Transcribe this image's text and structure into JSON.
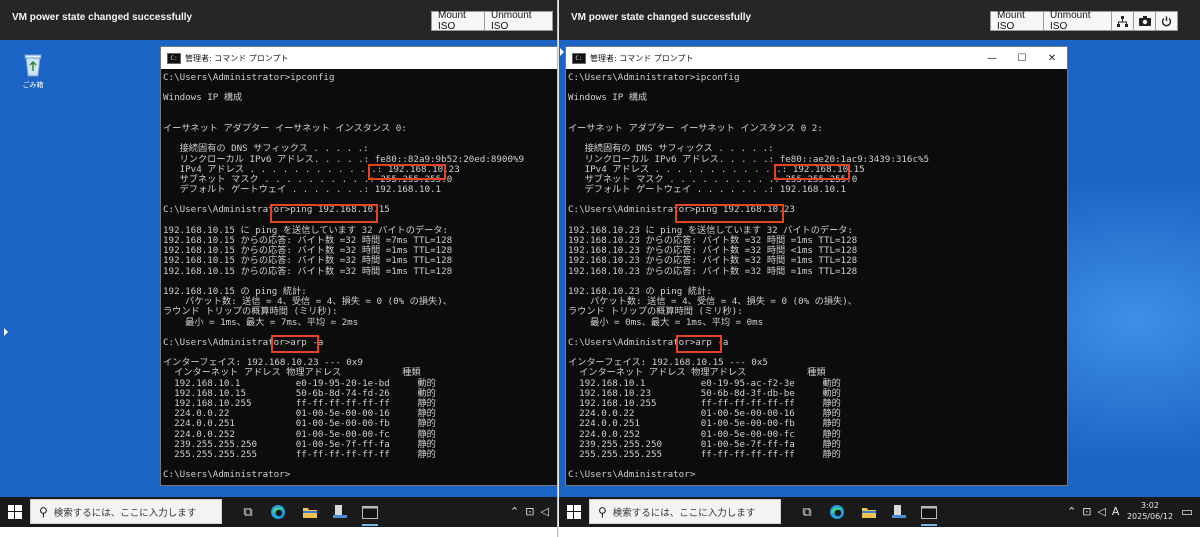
{
  "vm_status": "VM power state changed successfully",
  "buttons": {
    "mount_iso": "Mount ISO",
    "unmount_iso": "Unmount ISO"
  },
  "desktop": {
    "recycle_bin_label": "ごみ箱"
  },
  "cmd_title": "管理者: コマンド プロンプト",
  "taskbar": {
    "search_placeholder": "検索するには、ここに入力します",
    "ime": "A",
    "time": "3:02",
    "date": "2025/06/12"
  },
  "window_controls": {
    "minimize": "—",
    "maximize": "☐",
    "close": "✕"
  },
  "left_console": [
    "C:\\Users\\Administrator>ipconfig",
    "",
    "Windows IP 構成",
    "",
    "",
    "イーサネット アダプター イーサネット インスタンス 0:",
    "",
    "   接続固有の DNS サフィックス . . . . .:",
    "   リンクローカル IPv6 アドレス. . . . .: fe80::82a9:9b52:20ed:8900%9",
    "   IPv4 アドレス . . . . . . . . . . . .: 192.168.10.23",
    "   サブネット マスク . . . . . . . . . .: 255.255.255.0",
    "   デフォルト ゲートウェイ . . . . . . .: 192.168.10.1",
    "",
    "C:\\Users\\Administrator>ping 192.168.10.15",
    "",
    "192.168.10.15 に ping を送信しています 32 バイトのデータ:",
    "192.168.10.15 からの応答: バイト数 =32 時間 =7ms TTL=128",
    "192.168.10.15 からの応答: バイト数 =32 時間 =1ms TTL=128",
    "192.168.10.15 からの応答: バイト数 =32 時間 =1ms TTL=128",
    "192.168.10.15 からの応答: バイト数 =32 時間 =1ms TTL=128",
    "",
    "192.168.10.15 の ping 統計:",
    "    パケット数: 送信 = 4、受信 = 4、損失 = 0 (0% の損失)、",
    "ラウンド トリップの概算時間 (ミリ秒):",
    "    最小 = 1ms、最大 = 7ms、平均 = 2ms",
    "",
    "C:\\Users\\Administrator>arp -a",
    "",
    "インターフェイス: 192.168.10.23 --- 0x9",
    "  インターネット アドレス 物理アドレス           種類",
    "  192.168.10.1          e0-19-95-20-1e-bd     動的",
    "  192.168.10.15         50-6b-8d-74-fd-26     動的",
    "  192.168.10.255        ff-ff-ff-ff-ff-ff     静的",
    "  224.0.0.22            01-00-5e-00-00-16     静的",
    "  224.0.0.251           01-00-5e-00-00-fb     静的",
    "  224.0.0.252           01-00-5e-00-00-fc     静的",
    "  239.255.255.250       01-00-5e-7f-ff-fa     静的",
    "  255.255.255.255       ff-ff-ff-ff-ff-ff     静的",
    "",
    "C:\\Users\\Administrator>"
  ],
  "right_console": [
    "C:\\Users\\Administrator>ipconfig",
    "",
    "Windows IP 構成",
    "",
    "",
    "イーサネット アダプター イーサネット インスタンス 0 2:",
    "",
    "   接続固有の DNS サフィックス . . . . .:",
    "   リンクローカル IPv6 アドレス. . . . .: fe80::ae20:1ac9:3439:316c%5",
    "   IPv4 アドレス . . . . . . . . . . . .: 192.168.10.15",
    "   サブネット マスク . . . . . . . . . .: 255.255.255.0",
    "   デフォルト ゲートウェイ . . . . . . .: 192.168.10.1",
    "",
    "C:\\Users\\Administrator>ping 192.168.10.23",
    "",
    "192.168.10.23 に ping を送信しています 32 バイトのデータ:",
    "192.168.10.23 からの応答: バイト数 =32 時間 =1ms TTL=128",
    "192.168.10.23 からの応答: バイト数 =32 時間 <1ms TTL=128",
    "192.168.10.23 からの応答: バイト数 =32 時間 =1ms TTL=128",
    "192.168.10.23 からの応答: バイト数 =32 時間 =1ms TTL=128",
    "",
    "192.168.10.23 の ping 統計:",
    "    パケット数: 送信 = 4、受信 = 4、損失 = 0 (0% の損失)、",
    "ラウンド トリップの概算時間 (ミリ秒):",
    "    最小 = 0ms、最大 = 1ms、平均 = 0ms",
    "",
    "C:\\Users\\Administrator>arp -a",
    "",
    "インターフェイス: 192.168.10.15 --- 0x5",
    "  インターネット アドレス 物理アドレス           種類",
    "  192.168.10.1          e0-19-95-ac-f2-3e     動的",
    "  192.168.10.23         50-6b-8d-3f-db-be     動的",
    "  192.168.10.255        ff-ff-ff-ff-ff-ff     静的",
    "  224.0.0.22            01-00-5e-00-00-16     静的",
    "  224.0.0.251           01-00-5e-00-00-fb     静的",
    "  224.0.0.252           01-00-5e-00-00-fc     静的",
    "  239.255.255.250       01-00-5e-7f-ff-fa     静的",
    "  255.255.255.255       ff-ff-ff-ff-ff-ff     静的",
    "",
    "C:\\Users\\Administrator>"
  ],
  "colors": {
    "highlight": "#e2451f",
    "console_text": "#cfcfcf",
    "desktop": "#1b64c5",
    "vm_bar": "#262626"
  }
}
